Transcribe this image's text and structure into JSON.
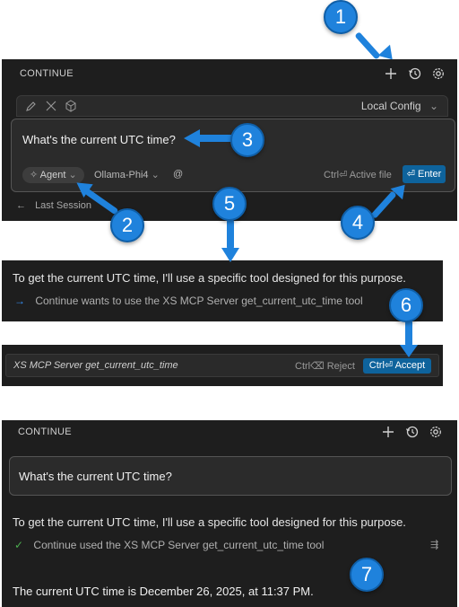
{
  "panel1": {
    "title": "CONTINUE",
    "config_label": "Local Config",
    "prompt": "What's the current UTC time?",
    "mode": "Agent",
    "model": "Ollama-Phi4",
    "at": "@",
    "active_file": "Ctrl⏎ Active file",
    "enter": "⏎ Enter",
    "last_session": "Last Session"
  },
  "panel2": {
    "response": "To get the current UTC time, I'll use a specific tool designed for this purpose.",
    "tool_notice": "Continue wants to use the XS MCP Server get_current_utc_time tool"
  },
  "panel3": {
    "tool_name": "XS MCP Server get_current_utc_time",
    "reject": "Ctrl⌫ Reject",
    "accept": "Ctrl⏎ Accept"
  },
  "panel4": {
    "title": "CONTINUE",
    "prompt": "What's the current UTC time?",
    "response": "To get the current UTC time, I'll use a specific tool designed for this purpose.",
    "tool_used": "Continue used the XS MCP Server get_current_utc_time tool",
    "answer": "The current UTC time is December 26, 2025, at 11:37 PM."
  },
  "callouts": [
    "1",
    "2",
    "3",
    "4",
    "5",
    "6",
    "7"
  ],
  "colors": {
    "accent": "#0e639c",
    "callout": "#1f82dc",
    "panel_bg": "#1e1e1e"
  }
}
